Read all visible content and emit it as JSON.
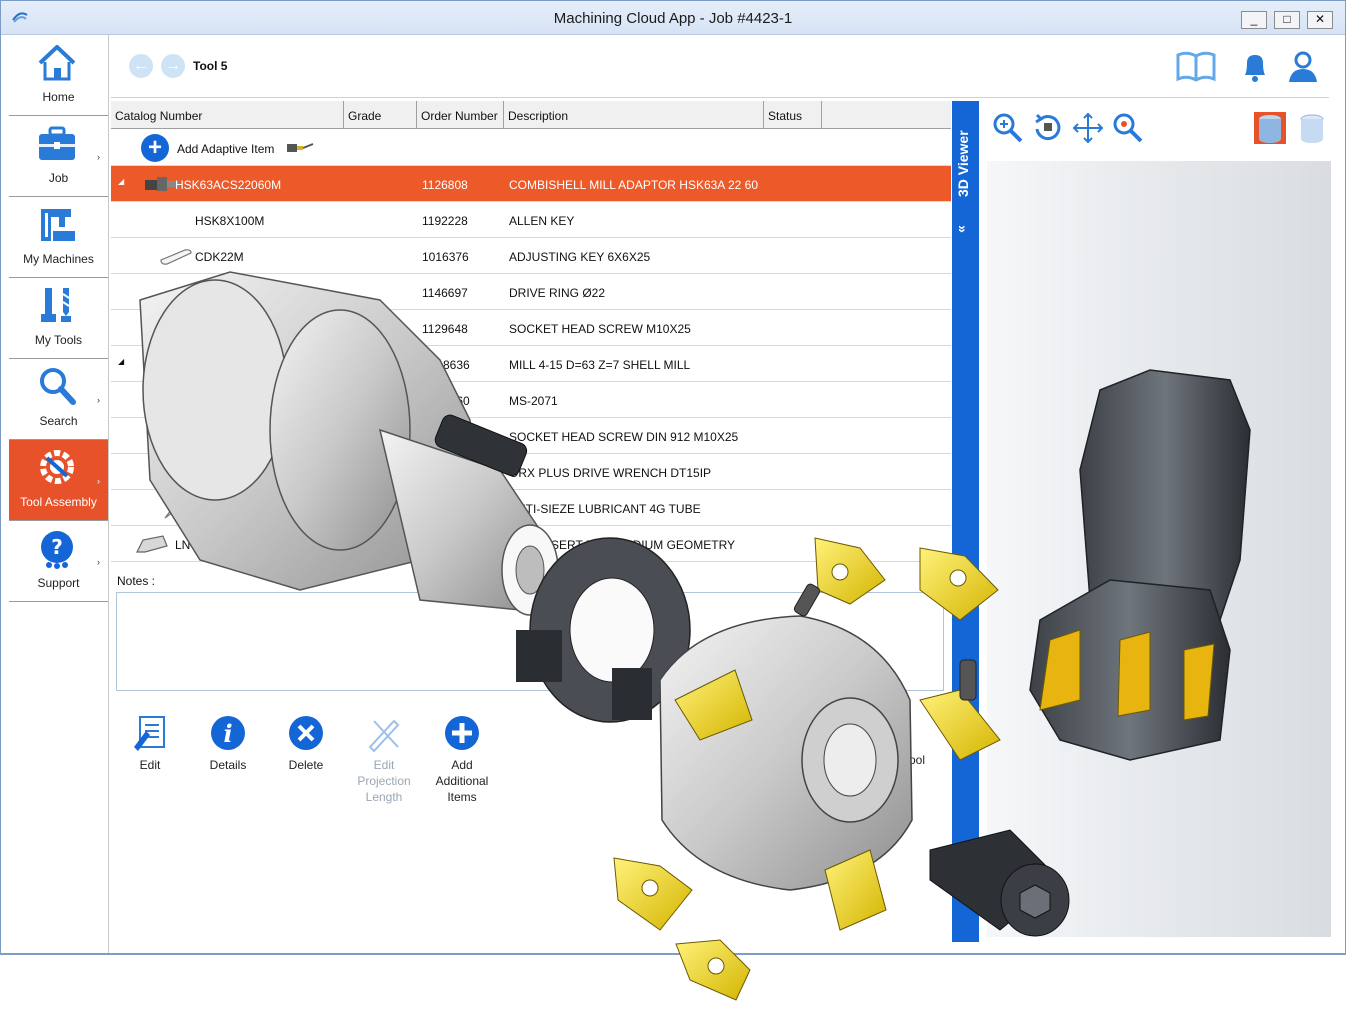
{
  "window": {
    "title": "Machining Cloud App - Job #4423-1",
    "controls": [
      "_",
      "□",
      "✕"
    ]
  },
  "sidebar": {
    "items": [
      {
        "label": "Home",
        "icon": "home-icon"
      },
      {
        "label": "Job",
        "icon": "briefcase-icon"
      },
      {
        "label": "My Machines",
        "icon": "machine-icon"
      },
      {
        "label": "My Tools",
        "icon": "tools-icon"
      },
      {
        "label": "Search",
        "icon": "search-icon"
      },
      {
        "label": "Tool Assembly",
        "icon": "tool-assembly-icon",
        "active": true
      },
      {
        "label": "Support",
        "icon": "support-icon"
      }
    ],
    "arrow": "›"
  },
  "toolbar": {
    "breadcrumb": "Tool 5",
    "back": "←",
    "forward": "→"
  },
  "grid": {
    "headers": [
      "Catalog Number",
      "Grade",
      "Order Number",
      "Description",
      "Status"
    ],
    "add_label": "Add Adaptive Item",
    "add_symbol": "+",
    "expand": "◢",
    "rows": [
      {
        "catalog": "HSK63ACS22060M",
        "order": "1126808",
        "description": "COMBISHELL MILL ADAPTOR HSK63A 22 60",
        "selected": true,
        "expand": true
      },
      {
        "catalog": "HSK8X100M",
        "order": "1192228",
        "description": "ALLEN KEY"
      },
      {
        "catalog": "CDK22M",
        "order": "1016376",
        "description": "ADJUSTING KEY 6X6X25"
      },
      {
        "catalog": "",
        "order": "1146697",
        "description": "DRIVE RING Ø22"
      },
      {
        "catalog": "",
        "order": "1129648",
        "description": "SOCKET HEAD SCREW M10X25"
      },
      {
        "catalog": "",
        "order": "8636",
        "description": "MILL 4-15 D=63 Z=7 SHELL MILL",
        "expand": true
      },
      {
        "catalog": "",
        "order": "0360",
        "description": "MS-2071"
      },
      {
        "catalog": "",
        "order": "",
        "description": "SOCKET HEAD SCREW DIN 912 M10X25"
      },
      {
        "catalog": "",
        "order": "",
        "description": "ORX PLUS DRIVE WRENCH  DT15IP"
      },
      {
        "catalog": "",
        "order": "",
        "description": "ANTI-SIEZE LUBRICANT 4G TUBE"
      },
      {
        "catalog": "LNGU151",
        "order": "",
        "description": "SERT R0.4 MEDIUM GEOMETRY"
      }
    ]
  },
  "notes": {
    "label": "Notes :"
  },
  "actions": [
    {
      "label": "Edit",
      "icon": "edit-icon"
    },
    {
      "label": "Details",
      "icon": "info-icon"
    },
    {
      "label": "Delete",
      "icon": "delete-icon"
    },
    {
      "label": "Edit Projection Length",
      "icon": "edit-projection-icon",
      "disabled": true
    },
    {
      "label": "Add Additional Items",
      "icon": "add-icon"
    }
  ],
  "viewer": {
    "tab_label": "3D Viewer",
    "tab_arrow": "»",
    "partial_label": "ool"
  },
  "colors": {
    "accent": "#1466d6",
    "selection": "#ec5a2a",
    "sidebar_active": "#e8522a",
    "insert": "#e8d93a"
  }
}
